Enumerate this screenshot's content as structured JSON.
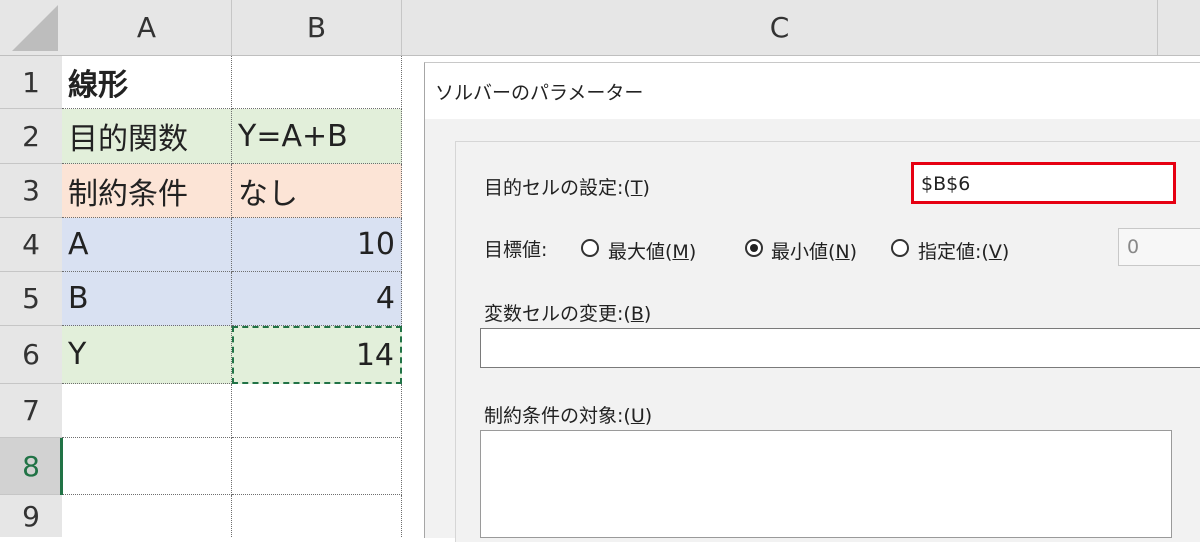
{
  "sheet": {
    "columns": [
      "A",
      "B",
      "C"
    ],
    "rows": [
      "1",
      "2",
      "3",
      "4",
      "5",
      "6",
      "7",
      "8",
      "9"
    ],
    "cells": {
      "a1": "線形",
      "a2": "目的関数",
      "b2": "Y=A+B",
      "a3": "制約条件",
      "b3": "なし",
      "a4": "A",
      "b4": "10",
      "a5": "B",
      "b5": "4",
      "a6": "Y",
      "b6": "14"
    },
    "fill_colors": {
      "green": "#e2efda",
      "orange": "#fce4d6",
      "blue": "#d9e1f2"
    },
    "active_row": "8"
  },
  "solver_dialog": {
    "title": "ソルバーのパラメーター",
    "objective_label_pre": "目的セルの設定:(",
    "objective_label_key": "T",
    "objective_label_post": ")",
    "objective_value": "$B$6",
    "objective_highlight_color": "#e60012",
    "target_label": "目標値:",
    "options": {
      "max_pre": "最大値(",
      "max_key": "M",
      "max_post": ")",
      "min_pre": "最小値(",
      "min_key": "N",
      "min_post": ")",
      "value_pre": "指定値:(",
      "value_key": "V",
      "value_post": ")"
    },
    "selected_option": "min",
    "specified_value": "0",
    "variables_label_pre": "変数セルの変更:(",
    "variables_label_key": "B",
    "variables_label_post": ")",
    "variables_value": "",
    "constraints_label_pre": "制約条件の対象:(",
    "constraints_label_key": "U",
    "constraints_label_post": ")"
  }
}
